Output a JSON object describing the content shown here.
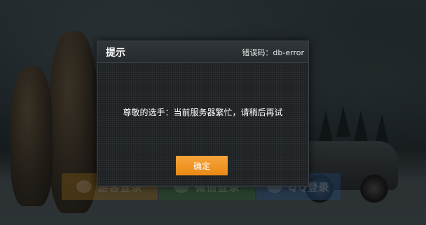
{
  "dialog": {
    "title": "提示",
    "error_code": "错误码：db-error",
    "message": "尊敬的选手：当前服务器繁忙，请稍后再试",
    "confirm_label": "确定"
  },
  "login_buttons": {
    "guest_label": "游客登录",
    "wechat_label": "微信登录",
    "qq_label": "QQ登录"
  },
  "colors": {
    "accent": "#f39a2a",
    "dialog_bg": "#1d2123"
  }
}
